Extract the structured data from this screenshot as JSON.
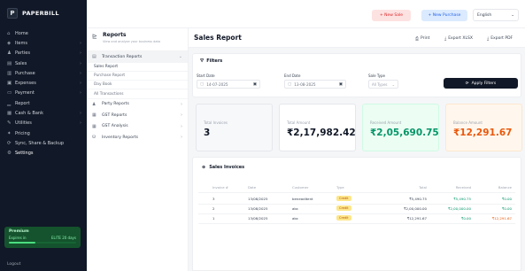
{
  "brand": {
    "name": "PAPERBILL",
    "logo_letter": "P"
  },
  "sidebar": {
    "items": [
      {
        "label": "Home",
        "icon": "home-icon",
        "glyph": "⌂",
        "chevron": false
      },
      {
        "label": "Items",
        "icon": "box-icon",
        "glyph": "◈",
        "chevron": true
      },
      {
        "label": "Parties",
        "icon": "users-icon",
        "glyph": "♟",
        "chevron": true
      },
      {
        "label": "Sales",
        "icon": "sales-icon",
        "glyph": "▤",
        "chevron": true
      },
      {
        "label": "Purchase",
        "icon": "cart-icon",
        "glyph": "▥",
        "chevron": true
      },
      {
        "label": "Expenses",
        "icon": "wallet-icon",
        "glyph": "▣",
        "chevron": true
      },
      {
        "label": "Payment",
        "icon": "card-icon",
        "glyph": "▭",
        "chevron": true
      },
      {
        "label": "Report",
        "icon": "chart-icon",
        "glyph": "▁",
        "chevron": false
      },
      {
        "label": "Cash & Bank",
        "icon": "bank-icon",
        "glyph": "▦",
        "chevron": true
      },
      {
        "label": "Utilities",
        "icon": "tool-icon",
        "glyph": "✎",
        "chevron": true
      },
      {
        "label": "Pricing",
        "icon": "tag-icon",
        "glyph": "✦",
        "chevron": false
      },
      {
        "label": "Sync, Share & Backup",
        "icon": "sync-icon",
        "glyph": "⟳",
        "chevron": false
      },
      {
        "label": "Settings",
        "icon": "gear-icon",
        "glyph": "⚙",
        "chevron": false
      }
    ],
    "premium": {
      "title": "Premium",
      "left": "Expires in",
      "right": "ELITE 20 days"
    },
    "footer": "Logout"
  },
  "topbar": {
    "new_sale": "+ New Sale",
    "new_purchase": "+ New Purchase",
    "language": "English"
  },
  "reports": {
    "title": "Reports",
    "subtitle": "View and analyze your business data",
    "groups": [
      {
        "label": "Transaction Reports",
        "icon": "document-icon",
        "glyph": "▤",
        "chevron": "⌄"
      },
      {
        "label": "Party Reports",
        "icon": "users-icon",
        "glyph": "♟",
        "chevron": "›"
      },
      {
        "label": "GST Reports",
        "icon": "gst-icon",
        "glyph": "▦",
        "chevron": "›"
      },
      {
        "label": "GST Analysis",
        "icon": "analysis-icon",
        "glyph": "▦",
        "chevron": "›"
      },
      {
        "label": "Inventory Reports",
        "icon": "inventory-icon",
        "glyph": "⛁",
        "chevron": "›"
      }
    ],
    "sub_items": [
      "Sales Report",
      "Purchase Report",
      "Day Book",
      "All Transactions"
    ]
  },
  "main": {
    "title": "Sales Report",
    "print": "Print",
    "export_xlsx": "Export XLSX",
    "export_pdf": "Export PDF"
  },
  "filters": {
    "title": "Filters",
    "start_label": "Start Date",
    "start_value": "14-07-2025",
    "end_label": "End Date",
    "end_value": "13-08-2025",
    "type_label": "Sale Type",
    "type_value": "All Types",
    "apply": "Apply Filters"
  },
  "summary": [
    {
      "label": "Total Invoices",
      "value": "3",
      "bg": "#f7f8fa",
      "border": "#e5e7eb",
      "color": "#111827"
    },
    {
      "label": "Total Amount",
      "value": "₹2,17,982.42",
      "bg": "#ffffff",
      "border": "#e5e7eb",
      "color": "#111827"
    },
    {
      "label": "Received Amount",
      "value": "₹2,05,690.75",
      "bg": "#ecfdf3",
      "border": "#d1fae5",
      "color": "#059669"
    },
    {
      "label": "Balance Amount",
      "value": "₹12,291.67",
      "bg": "#fff7ed",
      "border": "#fde7cf",
      "color": "#ea580c"
    }
  ],
  "invoices": {
    "title": "Sales Invoices",
    "columns": [
      "Invoice #",
      "Date",
      "Customer",
      "Type",
      "Total",
      "Received",
      "Balance"
    ],
    "rows": [
      {
        "invoice": "3",
        "date": "13/08/2025",
        "customer": "beneaditent",
        "type": "Credit",
        "total": "₹5,490.75",
        "received": "₹5,490.75",
        "balance": "₹0.00"
      },
      {
        "invoice": "2",
        "date": "13/08/2025",
        "customer": "abc",
        "type": "Credit",
        "total": "₹2,00,000.00",
        "received": "₹2,00,000.00",
        "balance": "₹0.00"
      },
      {
        "invoice": "1",
        "date": "13/08/2025",
        "customer": "abc",
        "type": "Credit",
        "total": "₹12,291.67",
        "received": "₹0.00",
        "balance": "₹12,291.67"
      }
    ]
  }
}
